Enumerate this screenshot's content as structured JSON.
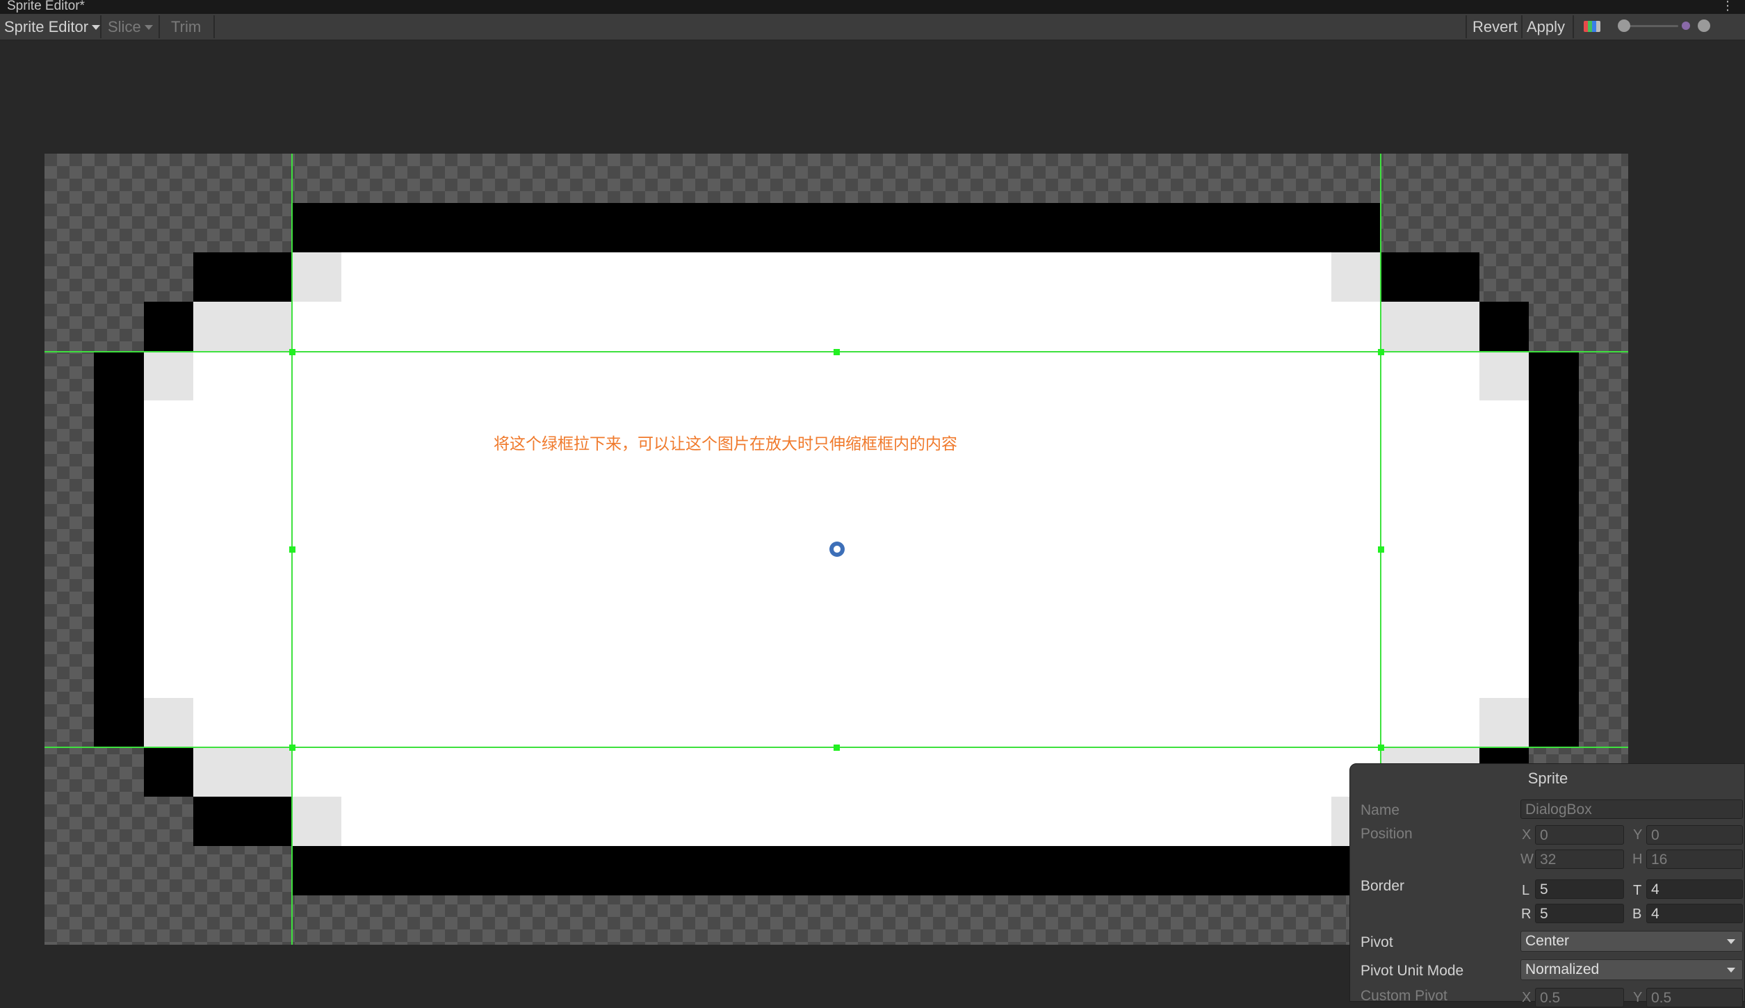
{
  "window": {
    "tab_title": "Sprite Editor*"
  },
  "toolbar": {
    "mode_label": "Sprite Editor",
    "slice_label": "Slice",
    "trim_label": "Trim",
    "revert_label": "Revert",
    "apply_label": "Apply"
  },
  "annotation": "将这个绿框拉下来，可以让这个图片在放大时只伸缩框框内的内容",
  "sprite_panel": {
    "title": "Sprite",
    "name_label": "Name",
    "name_value": "DialogBox",
    "position_label": "Position",
    "x_label": "X",
    "x_value": "0",
    "y_label": "Y",
    "y_value": "0",
    "w_label": "W",
    "w_value": "32",
    "h_label": "H",
    "h_value": "16",
    "border_label": "Border",
    "l_label": "L",
    "l_value": "5",
    "t_label": "T",
    "t_value": "4",
    "r_label": "R",
    "r_value": "5",
    "b_label": "B",
    "b_value": "4",
    "pivot_label": "Pivot",
    "pivot_value": "Center",
    "pivot_unit_mode_label": "Pivot Unit Mode",
    "pivot_unit_mode_value": "Normalized",
    "custom_pivot_label": "Custom Pivot",
    "custom_x_label": "X",
    "custom_x_value": "0.5",
    "custom_y_label": "Y",
    "custom_y_value": "0.5"
  },
  "colors": {
    "border_guides": "#3ee13e",
    "annotation": "#f07a2c",
    "pixel_dark": "#000000",
    "pixel_fill": "#ffffff",
    "pixel_light": "#e4e4e4"
  }
}
